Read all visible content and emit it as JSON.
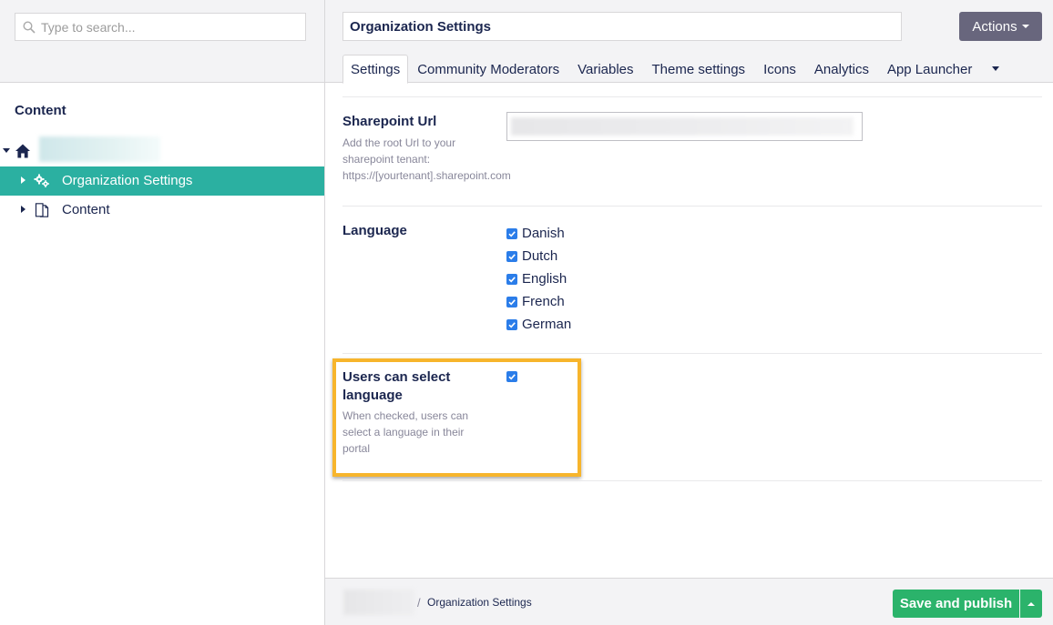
{
  "sidebar": {
    "search_placeholder": "Type to search...",
    "tree_title": "Content",
    "items": [
      {
        "label": "Organization Settings",
        "icon": "cogs-icon",
        "active": true
      },
      {
        "label": "Content",
        "icon": "documents-icon",
        "active": false
      }
    ]
  },
  "header": {
    "node_name": "Organization Settings",
    "actions_label": "Actions",
    "tabs": [
      "Settings",
      "Community Moderators",
      "Variables",
      "Theme settings",
      "Icons",
      "Analytics",
      "App Launcher"
    ]
  },
  "properties": {
    "sharepoint": {
      "label": "Sharepoint Url",
      "description": [
        "Add the root Url to your",
        "sharepoint tenant:",
        "https://[yourtenant].sharepoint.com"
      ]
    },
    "language": {
      "label": "Language",
      "options": [
        {
          "name": "Danish",
          "checked": true
        },
        {
          "name": "Dutch",
          "checked": true
        },
        {
          "name": "English",
          "checked": true
        },
        {
          "name": "French",
          "checked": true
        },
        {
          "name": "German",
          "checked": true
        }
      ]
    },
    "users_can_select": {
      "label_line1": "Users can select",
      "label_line2": "language",
      "description": [
        "When checked, users can",
        "select a language in their",
        "portal"
      ],
      "checked": true
    }
  },
  "footer": {
    "breadcrumb_separator": "/",
    "breadcrumb_current": "Organization Settings",
    "save_label": "Save and publish"
  },
  "colors": {
    "accent_teal": "#2bb0a1",
    "save_green": "#2bb36b",
    "actions_gray": "#68667d",
    "checkbox_blue": "#2b7de9",
    "highlight_orange": "#f7b52c",
    "text_navy": "#1b264f"
  }
}
